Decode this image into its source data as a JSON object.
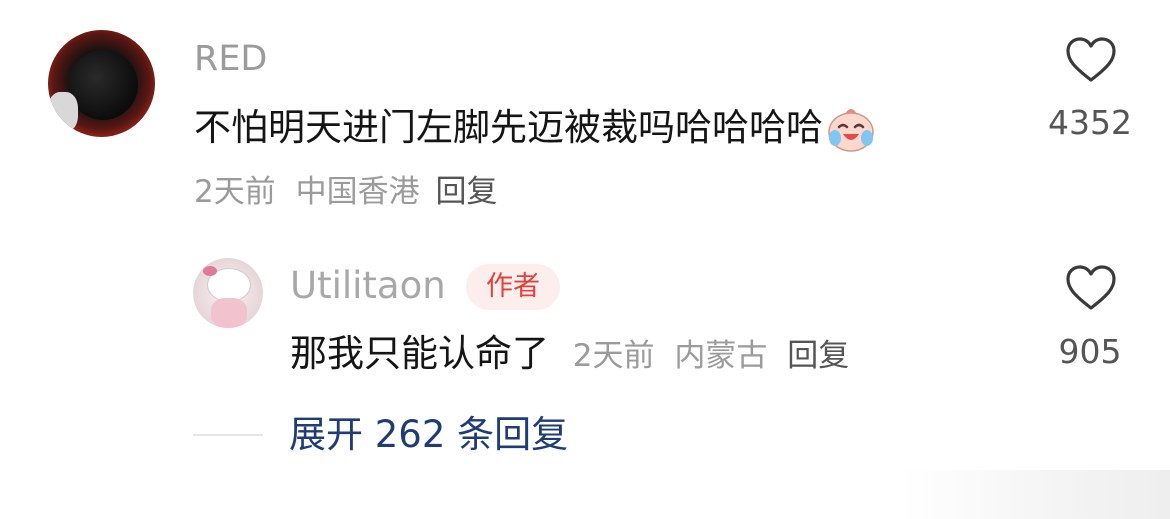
{
  "comment": {
    "username": "RED",
    "text": "不怕明天进门左脚先迈被裁吗哈哈哈哈",
    "emoji_icon": "laughing-crying-emoji-icon",
    "time": "2天前",
    "location": "中国香港",
    "reply_label": "回复",
    "likes": "4352"
  },
  "reply": {
    "username": "Utilitaon",
    "badge": "作者",
    "text": "那我只能认命了",
    "time": "2天前",
    "location": "内蒙古",
    "reply_label": "回复",
    "likes": "905"
  },
  "expand": {
    "label": "展开 262 条回复"
  },
  "colors": {
    "text_primary": "#151515",
    "text_secondary": "#9b9b9b",
    "link_blue": "#1f3d74",
    "badge_red": "#e1423c",
    "badge_bg": "#fdeeee"
  }
}
